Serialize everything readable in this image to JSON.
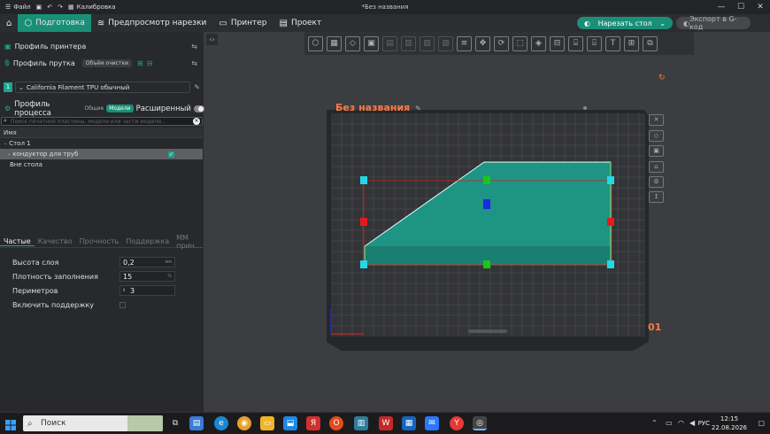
{
  "titlebar": {
    "file_label": "Файл",
    "calibration_label": "Калибровка",
    "project_title": "*Без названия",
    "min": "—",
    "max": "☐",
    "close": "✕"
  },
  "navbar": {
    "tabs": [
      "Подготовка",
      "Предпросмотр нарезки",
      "Принтер",
      "Проект"
    ],
    "slice_label": "Нарезать стол",
    "export_label": "Экспорт в G-код"
  },
  "left": {
    "printer_profile": "Профиль принтера",
    "filament_profile": "Профиль прутка",
    "flush_volume": "Объём очистки",
    "filament_index": "1",
    "filament_name": "California Filament TPU обычный",
    "process_profile": "Профиль процесса",
    "seg_global": "Общие",
    "seg_objects": "Модели",
    "advanced": "Расширенный",
    "search_placeholder": "Поиск печатной пластины, модели или части модели...",
    "tree_header": "Имя",
    "tree": [
      "Стол 1",
      "кондуктор для труб",
      "Вне стола"
    ],
    "tabs": [
      "Частые",
      "Качество",
      "Прочность",
      "Поддержка",
      "ММ прин..."
    ],
    "params": [
      {
        "label": "Высота слоя",
        "value": "0,2",
        "unit": "мм"
      },
      {
        "label": "Плотность заполнения",
        "value": "15",
        "unit": "%"
      },
      {
        "label": "Периметров",
        "value": "3",
        "unit": ""
      },
      {
        "label": "Включить поддержку",
        "value": "",
        "unit": ""
      }
    ]
  },
  "viewport": {
    "plate_name": "Без названия",
    "plate_number": "01"
  },
  "taskbar": {
    "search": "Поиск",
    "lang": "РУС",
    "time": "12:15",
    "date": "22.08.2026"
  }
}
